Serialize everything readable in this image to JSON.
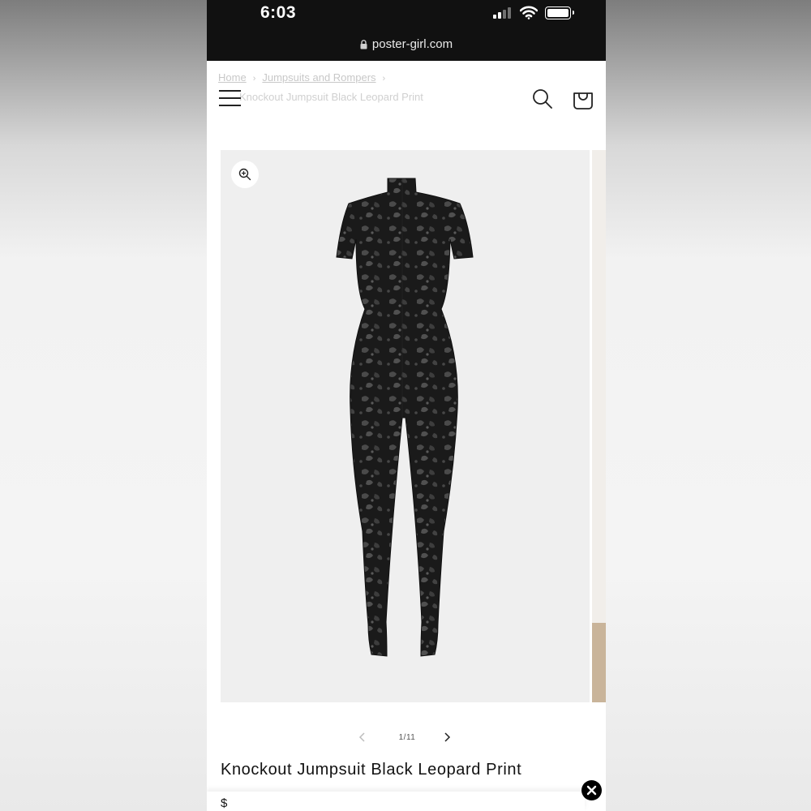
{
  "status_bar": {
    "time": "6:03",
    "url": "poster-girl.com"
  },
  "breadcrumb": {
    "items": [
      "Home",
      "Jumpsuits and Rompers"
    ],
    "current": "Knockout Jumpsuit Black Leopard Print"
  },
  "icons": {
    "menu": "hamburger-icon",
    "search": "search-icon",
    "cart": "cart-icon",
    "zoom": "zoom-in-icon",
    "prev": "chevron-left-icon",
    "next": "chevron-right-icon",
    "close": "close-icon"
  },
  "gallery": {
    "counter": "1/11",
    "current_index": 1,
    "total": 11
  },
  "product": {
    "title": "Knockout Jumpsuit Black Leopard Print",
    "price": "$"
  },
  "colors": {
    "status_bar_bg": "#111111",
    "gallery_bg": "#efefef",
    "text": "#121212"
  }
}
